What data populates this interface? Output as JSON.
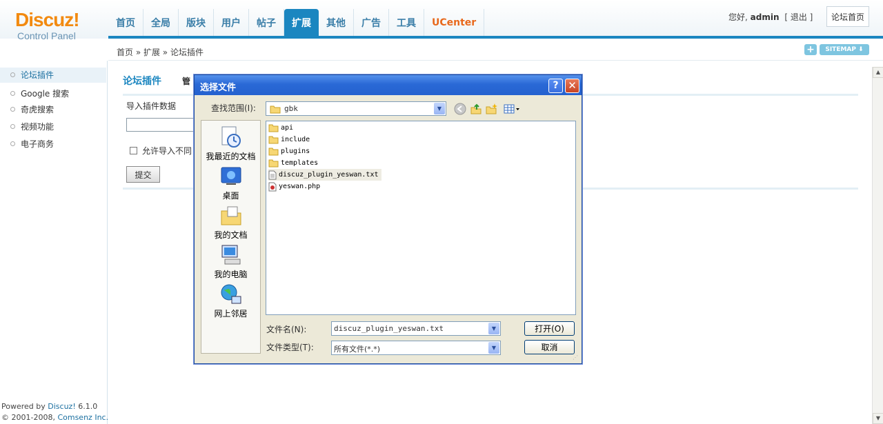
{
  "logo": {
    "brand": "Discuz!",
    "sub": "Control Panel"
  },
  "nav": [
    {
      "label": "首页",
      "name": "nav-home"
    },
    {
      "label": "全局",
      "name": "nav-global"
    },
    {
      "label": "版块",
      "name": "nav-forums"
    },
    {
      "label": "用户",
      "name": "nav-users"
    },
    {
      "label": "帖子",
      "name": "nav-posts"
    },
    {
      "label": "扩展",
      "name": "nav-extend",
      "active": true
    },
    {
      "label": "其他",
      "name": "nav-other"
    },
    {
      "label": "广告",
      "name": "nav-ads"
    },
    {
      "label": "工具",
      "name": "nav-tools"
    },
    {
      "label": "UCenter",
      "name": "nav-ucenter"
    }
  ],
  "userbar": {
    "greeting": "您好,",
    "user": "admin",
    "logout": "[ 退出 ]"
  },
  "home_button": "论坛首页",
  "breadcrumb": "首页 » 扩展 » 论坛插件",
  "toolbar": {
    "plus": "+",
    "sitemap": "SITEMAP ⬇"
  },
  "sidebar": [
    {
      "label": "论坛插件",
      "active": true
    },
    {
      "label": "Google 搜索"
    },
    {
      "label": "奇虎搜索"
    },
    {
      "label": "视频功能"
    },
    {
      "label": "电子商务"
    }
  ],
  "footer": {
    "line1_prefix": "Powered by ",
    "line1_link": "Discuz!",
    "line1_suffix": " 6.1.0",
    "line2_prefix": "© 2001-2008, ",
    "line2_link": "Comsenz Inc."
  },
  "main": {
    "title": "论坛插件",
    "tab_partial": "管",
    "import_label": "导入插件数据",
    "allow_label": "允许导入不同",
    "submit": "提交"
  },
  "dialog": {
    "title": "选择文件",
    "help": "?",
    "close": "✕",
    "lookin_label": "查找范围(I):",
    "lookin_value": "gbk",
    "places": [
      "我最近的文档",
      "桌面",
      "我的文档",
      "我的电脑",
      "网上邻居"
    ],
    "files": [
      {
        "name": "api",
        "type": "folder"
      },
      {
        "name": "include",
        "type": "folder"
      },
      {
        "name": "plugins",
        "type": "folder"
      },
      {
        "name": "templates",
        "type": "folder"
      },
      {
        "name": "discuz_plugin_yeswan.txt",
        "type": "txt",
        "selected": true
      },
      {
        "name": "yeswan.php",
        "type": "php"
      }
    ],
    "filename_label": "文件名(N):",
    "filename_value": "discuz_plugin_yeswan.txt",
    "filetype_label": "文件类型(T):",
    "filetype_value": "所有文件(*.*)",
    "open": "打开(O)",
    "cancel": "取消"
  },
  "colors": {
    "accent": "#1b86c0",
    "logo": "#f28a10",
    "ucenter": "#e8681b",
    "xp_title": "#2a69d6"
  }
}
